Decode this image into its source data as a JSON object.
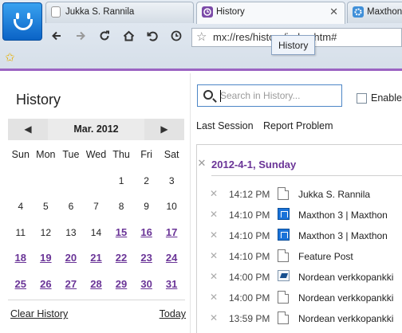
{
  "tabs": [
    {
      "label": "Jukka S. Rannila",
      "active": false
    },
    {
      "label": "History",
      "active": true
    },
    {
      "label": "Maxthon",
      "active": false
    }
  ],
  "address": {
    "value": "mx://res/history/index.htm#"
  },
  "tooltip": "History",
  "colors": {
    "accent": "#6a3497",
    "accent_line": "#9b63c2",
    "search_border": "#4d86c6"
  },
  "icons": {
    "back": "arrow-left-icon",
    "forward": "arrow-right-icon",
    "refresh": "refresh-icon",
    "home": "home-icon",
    "undo": "undo-icon",
    "history": "clock-icon",
    "favorite": "star-icon"
  },
  "left": {
    "title": "History",
    "calendar": {
      "month": "Mar. 2012",
      "prev": "◀",
      "next": "▶",
      "weekdays": [
        "Sun",
        "Mon",
        "Tue",
        "Wed",
        "Thu",
        "Fri",
        "Sat"
      ],
      "weeks": [
        [
          {
            "d": "",
            "link": false
          },
          {
            "d": "",
            "link": false
          },
          {
            "d": "",
            "link": false
          },
          {
            "d": "",
            "link": false
          },
          {
            "d": "1",
            "link": false
          },
          {
            "d": "2",
            "link": false
          },
          {
            "d": "3",
            "link": false
          }
        ],
        [
          {
            "d": "4",
            "link": false
          },
          {
            "d": "5",
            "link": false
          },
          {
            "d": "6",
            "link": false
          },
          {
            "d": "7",
            "link": false
          },
          {
            "d": "8",
            "link": false
          },
          {
            "d": "9",
            "link": false
          },
          {
            "d": "10",
            "link": false
          }
        ],
        [
          {
            "d": "11",
            "link": false
          },
          {
            "d": "12",
            "link": false
          },
          {
            "d": "13",
            "link": false
          },
          {
            "d": "14",
            "link": false
          },
          {
            "d": "15",
            "link": true
          },
          {
            "d": "16",
            "link": true
          },
          {
            "d": "17",
            "link": true
          }
        ],
        [
          {
            "d": "18",
            "link": true
          },
          {
            "d": "19",
            "link": true
          },
          {
            "d": "20",
            "link": true
          },
          {
            "d": "21",
            "link": true
          },
          {
            "d": "22",
            "link": true
          },
          {
            "d": "23",
            "link": true
          },
          {
            "d": "24",
            "link": true
          }
        ],
        [
          {
            "d": "25",
            "link": true
          },
          {
            "d": "26",
            "link": true
          },
          {
            "d": "27",
            "link": true
          },
          {
            "d": "28",
            "link": true
          },
          {
            "d": "29",
            "link": true
          },
          {
            "d": "30",
            "link": true
          },
          {
            "d": "31",
            "link": true
          }
        ]
      ]
    },
    "clear_history": "Clear History",
    "today": "Today"
  },
  "right": {
    "search_placeholder": "Search in History...",
    "enable_label": "Enable",
    "actions": [
      "Last Session",
      "Report Problem"
    ],
    "day_heading": "2012-4-1, Sunday",
    "entries": [
      {
        "time": "14:12 PM",
        "icon": "page",
        "title": "Jukka S. Rannila"
      },
      {
        "time": "14:10 PM",
        "icon": "mx",
        "title": "Maxthon 3 | Maxthon"
      },
      {
        "time": "14:10 PM",
        "icon": "mx",
        "title": "Maxthon 3 | Maxthon"
      },
      {
        "time": "14:10 PM",
        "icon": "page",
        "title": "Feature Post"
      },
      {
        "time": "14:00 PM",
        "icon": "bank",
        "title": "Nordean verkkopankki"
      },
      {
        "time": "14:00 PM",
        "icon": "page",
        "title": "Nordean verkkopankki"
      },
      {
        "time": "13:59 PM",
        "icon": "page",
        "title": "Nordean verkkopankki"
      }
    ]
  }
}
